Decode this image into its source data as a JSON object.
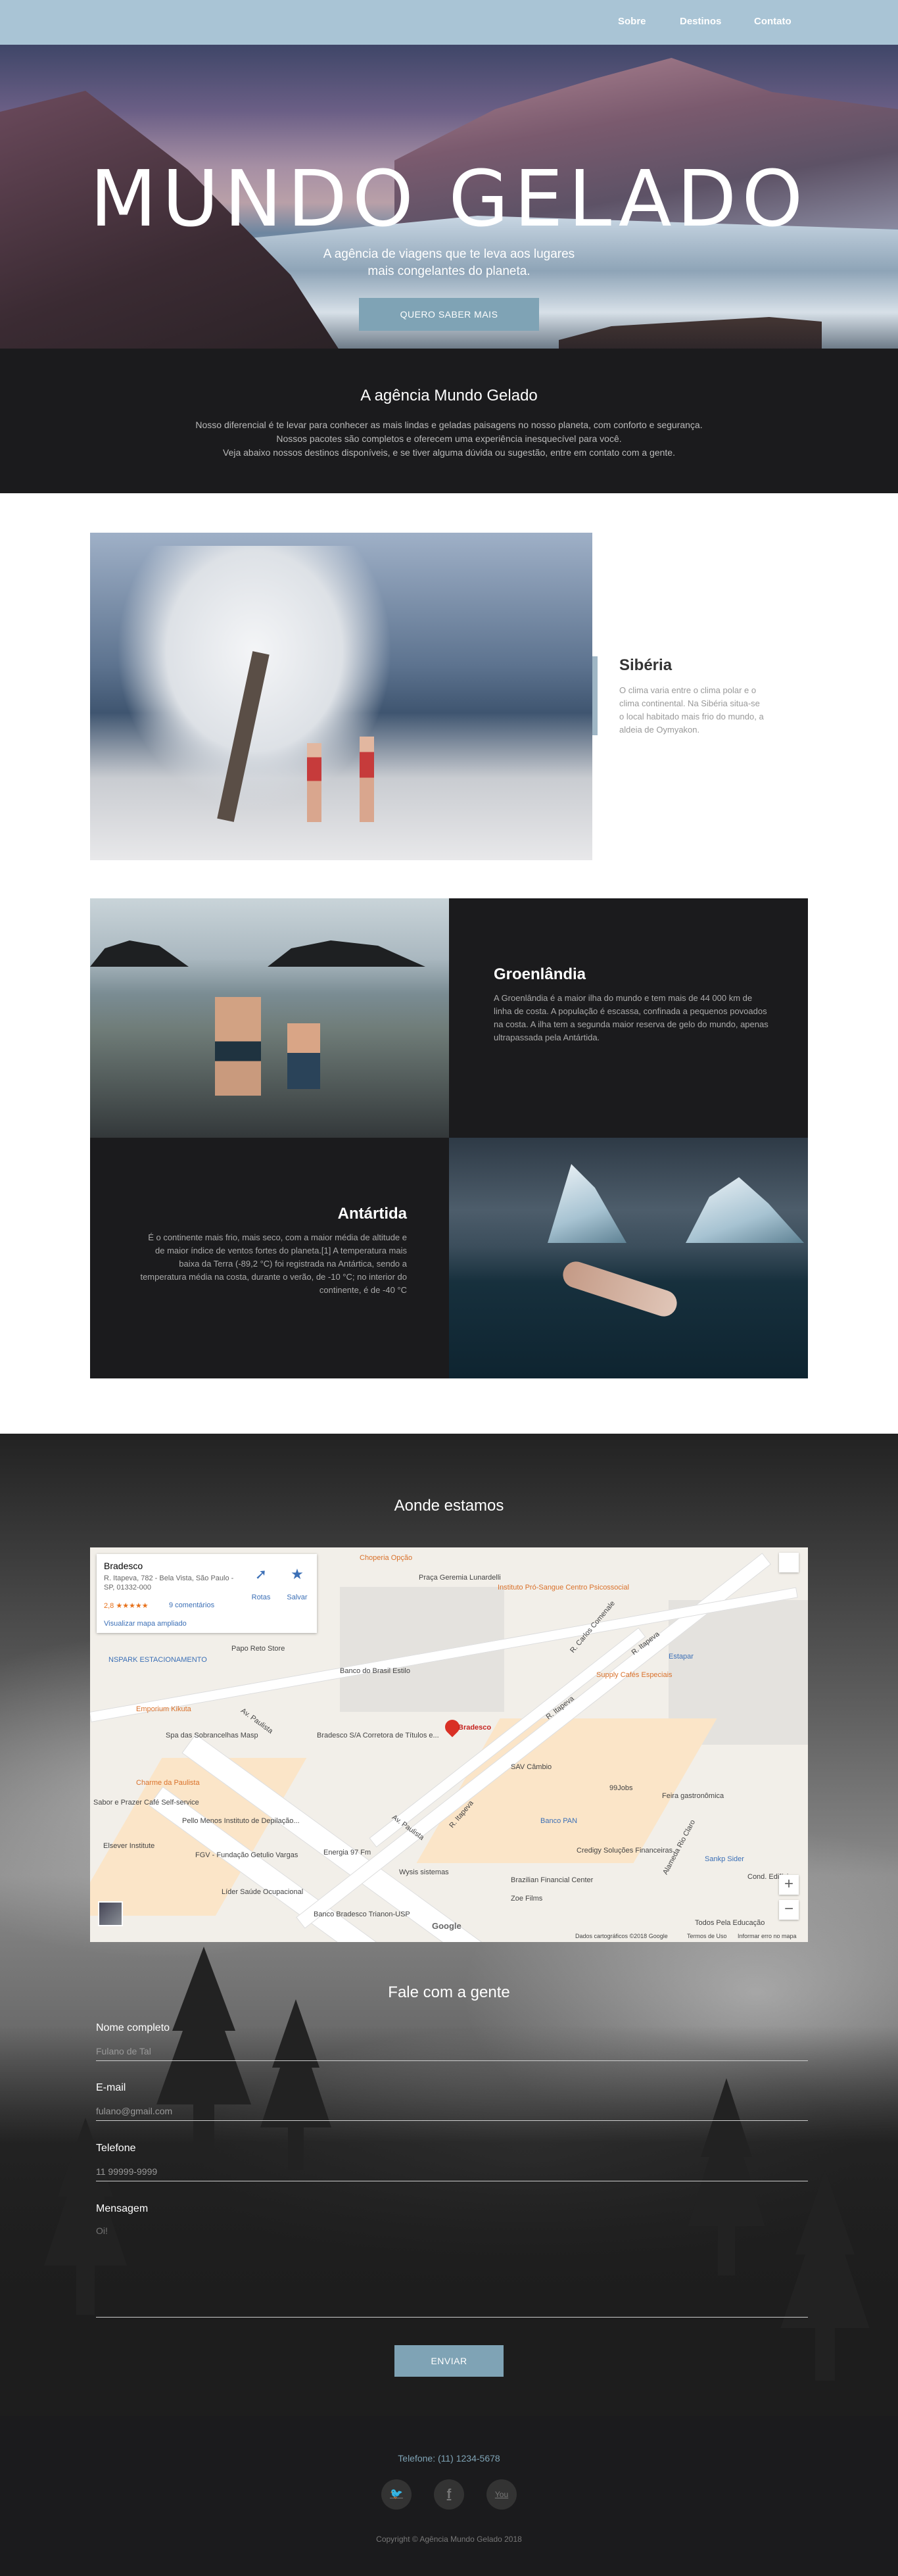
{
  "nav": {
    "items": [
      {
        "label": "Sobre"
      },
      {
        "label": "Destinos"
      },
      {
        "label": "Contato"
      }
    ]
  },
  "hero": {
    "title": "MUNDO GELADO",
    "subtitle_line1": "A agência de viagens que te leva aos lugares",
    "subtitle_line2": "mais congelantes do planeta.",
    "button_label": "QUERO SABER MAIS"
  },
  "about": {
    "title": "A agência Mundo Gelado",
    "line1": "Nosso diferencial é te levar para conhecer as mais lindas e geladas paisagens no nosso planeta, com conforto e segurança.",
    "line2": "Nossos pacotes são completos e oferecem uma experiência inesquecível para você.",
    "line3": "Veja abaixo nossos destinos disponíveis, e se tiver alguma dúvida ou sugestão, entre em contato com a gente."
  },
  "destinations": {
    "siberia": {
      "title": "Sibéria",
      "text": "O clima varia entre o clima polar e o clima continental. Na Sibéria situa-se o local habitado mais frio do mundo, a aldeia de Oymyakon."
    },
    "greenland": {
      "title": "Groenlândia",
      "text": "A Groenlândia é a maior ilha do mundo e tem mais de 44 000 km de linha de costa. A população é escassa, confinada a pequenos povoados na costa. A ilha tem a segunda maior reserva de gelo do mundo, apenas ultrapassada pela Antártida."
    },
    "antarctica": {
      "title": "Antártida",
      "text": "É o continente mais frio, mais seco, com a maior média de altitude e de maior índice de ventos fortes do planeta.[1] A temperatura mais baixa da Terra (-89,2 °C) foi registrada na Antártica, sendo a temperatura média na costa, durante o verão, de -10 °C; no interior do continente, é de -40 °C"
    }
  },
  "location": {
    "title": "Aonde estamos",
    "map": {
      "place_name": "Bradesco",
      "address": "R. Itapeva, 782 - Bela Vista, São Paulo - SP, 01332-000",
      "rating": "2,8 ★★★★★",
      "reviews": "9 comentários",
      "directions_label": "Rotas",
      "save_label": "Salvar",
      "larger_map": "Visualizar mapa ampliado",
      "marker_label": "Bradesco",
      "zoom_in": "+",
      "zoom_out": "−",
      "footer_data": "Dados cartográficos ©2018 Google",
      "footer_terms": "Termos de Uso",
      "footer_report": "Informar erro no mapa",
      "google": "Google",
      "pois": [
        {
          "label": "Choperia Opção"
        },
        {
          "label": "Praça Geremia Lunardelli"
        },
        {
          "label": "Instituto Pró-Sangue Centro Psicossocial"
        },
        {
          "label": "Estapar"
        },
        {
          "label": "Papo Reto Store"
        },
        {
          "label": "NSPARK ESTACIONAMENTO"
        },
        {
          "label": "Banco do Brasil Estilo"
        },
        {
          "label": "Supply Cafés Especiais"
        },
        {
          "label": "Emporium Kikuta"
        },
        {
          "label": "Spa das Sobrancelhas Masp"
        },
        {
          "label": "Bradesco S/A Corretora de Títulos e..."
        },
        {
          "label": "SAV Câmbio"
        },
        {
          "label": "99Jobs"
        },
        {
          "label": "Charme da Paulista"
        },
        {
          "label": "Feira gastronômica"
        },
        {
          "label": "Sabor e Prazer Café Self-service"
        },
        {
          "label": "Pello Menos Instituto de Depilação..."
        },
        {
          "label": "Banco PAN"
        },
        {
          "label": "Elsever Institute"
        },
        {
          "label": "Energia 97 Fm"
        },
        {
          "label": "Credigy Soluções Financeiras"
        },
        {
          "label": "Sankp Sider"
        },
        {
          "label": "FGV - Fundação Getulio Vargas"
        },
        {
          "label": "Wysis sistemas"
        },
        {
          "label": "Brazilian Financial Center"
        },
        {
          "label": "Líder Saúde Ocupacional"
        },
        {
          "label": "Zoe Films"
        },
        {
          "label": "Banco Bradesco Trianon-USP"
        },
        {
          "label": "Todos Pela Educação"
        },
        {
          "label": "Cond. Edifício"
        },
        {
          "label": "Av. Paulista"
        },
        {
          "label": "Av. Paulista"
        },
        {
          "label": "R. Itapeva"
        },
        {
          "label": "R. Itapeva"
        },
        {
          "label": "R. Itapeva"
        },
        {
          "label": "R. Carlos Comenale"
        },
        {
          "label": "Alameda Rio Claro"
        }
      ]
    }
  },
  "contact_form": {
    "title": "Fale com a gente",
    "name_label": "Nome completo",
    "name_placeholder": "Fulano de Tal",
    "email_label": "E-mail",
    "email_placeholder": "fulano@gmail.com",
    "phone_label": "Telefone",
    "phone_placeholder": "11 99999-9999",
    "message_label": "Mensagem",
    "message_placeholder": "Oi!",
    "send_label": "ENVIAR"
  },
  "footer": {
    "phone": "Telefone: (11) 1234-5678",
    "social": [
      {
        "name": "twitter-icon",
        "glyph": "🐦"
      },
      {
        "name": "facebook-icon",
        "glyph": "f"
      },
      {
        "name": "youtube-icon",
        "glyph": "You"
      }
    ],
    "copyright": "Copyright © Agência Mundo Gelado 2018"
  },
  "colors": {
    "nav_bg": "#a9c4d5",
    "accent": "#7fa3b5",
    "dark_bg": "#1b1b1d"
  }
}
